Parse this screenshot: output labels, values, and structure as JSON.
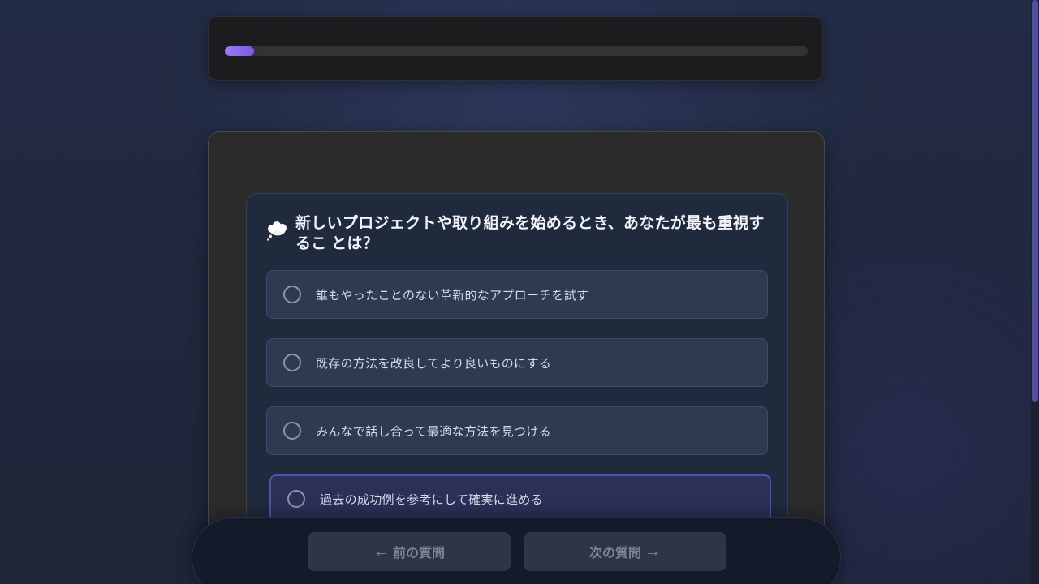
{
  "progress": {
    "value": 0.05
  },
  "question": {
    "icon": "thought-bubble-icon",
    "text": "新しいプロジェクトや取り組みを始めるとき、あなたが最も重視するこ とは？"
  },
  "options": [
    {
      "label": "誰もやったことのない革新的なアプローチを試す"
    },
    {
      "label": "既存の方法を改良してより良いものにする"
    },
    {
      "label": "みんなで話し合って最適な方法を見つける"
    },
    {
      "label": "過去の成功例を参考にして確実に進める"
    }
  ],
  "navigation": {
    "prev_arrow": "←",
    "prev_label": "前の質問",
    "next_label": "次の質問",
    "next_arrow": "→"
  },
  "colors": {
    "accent": "#8b6cf2",
    "background": "#1f273a",
    "card": "#2b2b2b"
  }
}
